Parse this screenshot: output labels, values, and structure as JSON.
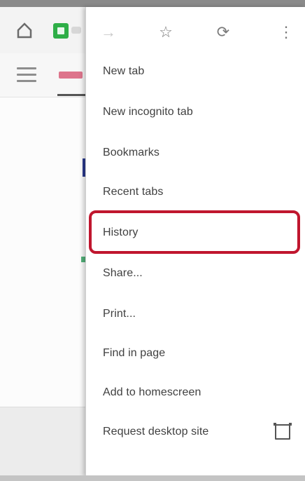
{
  "menu": {
    "actions": [
      {
        "name": "forward",
        "icon": "forward-arrow-icon",
        "glyph": "→"
      },
      {
        "name": "bookmark",
        "icon": "star-icon",
        "glyph": "☆"
      },
      {
        "name": "reload",
        "icon": "reload-icon",
        "glyph": "⟳"
      },
      {
        "name": "more",
        "icon": "more-vert-icon",
        "glyph": "⋮"
      }
    ],
    "items": [
      {
        "label": "New tab"
      },
      {
        "label": "New incognito tab"
      },
      {
        "label": "Bookmarks"
      },
      {
        "label": "Recent tabs"
      },
      {
        "label": "History"
      },
      {
        "label": "Share..."
      },
      {
        "label": "Print..."
      },
      {
        "label": "Find in page"
      },
      {
        "label": "Add to homescreen"
      },
      {
        "label": "Request desktop site"
      }
    ]
  },
  "colors": {
    "highlight": "#c0162e",
    "extension": "#2eae47",
    "active_tab": "#d65470"
  }
}
